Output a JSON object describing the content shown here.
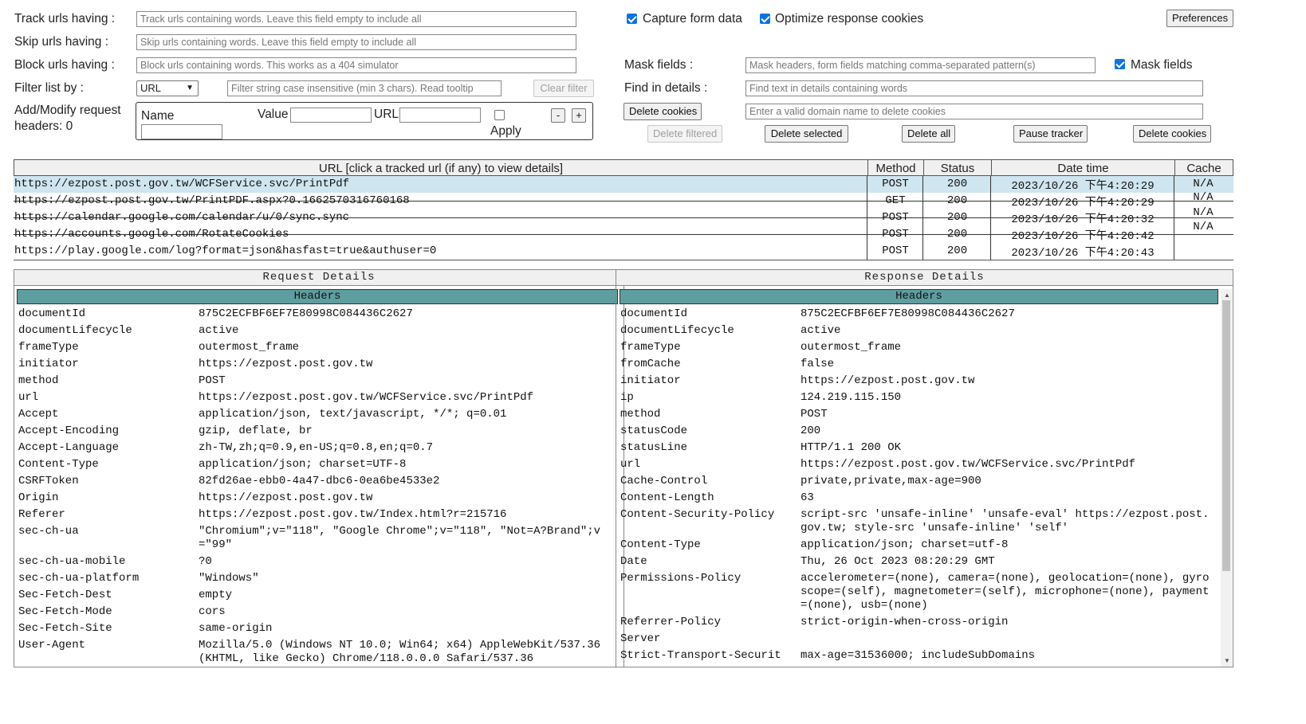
{
  "controls": {
    "track_label": "Track urls having :",
    "track_placeholder": "Track urls containing words. Leave this field empty to include all",
    "skip_label": "Skip urls having :",
    "skip_placeholder": "Skip urls containing words. Leave this field empty to include all",
    "block_label": "Block urls having :",
    "block_placeholder": "Block urls containing words. This works as a 404 simulator",
    "filter_label": "Filter list by :",
    "filter_select": "URL",
    "filter_placeholder": "Filter string case insensitive (min 3 chars). Read tooltip",
    "clear_filter": "Clear filter",
    "add_modify_label_1": "Add/Modify request",
    "add_modify_label_2": "headers: 0",
    "name_label": "Name",
    "value_label": "Value",
    "url_label": "URL",
    "apply_label": "Apply",
    "minus": "-",
    "plus": "+",
    "capture_form": "Capture form data",
    "optimize_cookies": "Optimize response cookies",
    "preferences": "Preferences",
    "mask_fields_label": "Mask fields :",
    "mask_placeholder": "Mask headers, form fields matching comma-separated pattern(s)",
    "mask_fields_check": "Mask fields",
    "find_label": "Find in details :",
    "find_placeholder": "Find text in details containing words",
    "delete_cookies": "Delete cookies",
    "domain_placeholder": "Enter a valid domain name to delete cookies",
    "delete_filtered": "Delete filtered",
    "delete_selected": "Delete selected",
    "delete_all": "Delete all",
    "pause_tracker": "Pause tracker",
    "delete_cookies_2": "Delete cookies"
  },
  "table": {
    "headers": [
      "URL [click a tracked url (if any) to view details]",
      "Method",
      "Status",
      "Date time",
      "Cache"
    ],
    "rows": [
      {
        "url": "https://ezpost.post.gov.tw/WCFService.svc/PrintPdf",
        "method": "POST",
        "status": "200",
        "date": "2023/10/26 下午4:20:29",
        "cache": "N/A"
      },
      {
        "url": "https://ezpost.post.gov.tw/PrintPDF.aspx?0.1662570316760168",
        "method": "GET",
        "status": "200",
        "date": "2023/10/26 下午4:20:29",
        "cache": "N/A"
      },
      {
        "url": "https://calendar.google.com/calendar/u/0/sync.sync",
        "method": "POST",
        "status": "200",
        "date": "2023/10/26 下午4:20:32",
        "cache": "N/A"
      },
      {
        "url": "https://accounts.google.com/RotateCookies",
        "method": "POST",
        "status": "200",
        "date": "2023/10/26 下午4:20:42",
        "cache": "N/A"
      },
      {
        "url": "https://play.google.com/log?format=json&hasfast=true&authuser=0",
        "method": "POST",
        "status": "200",
        "date": "2023/10/26 下午4:20:43",
        "cache": ""
      }
    ]
  },
  "request": {
    "title": "Request Details",
    "headers_bar": "Headers",
    "items": [
      [
        "documentId",
        "875C2ECFBF6EF7E80998C084436C2627"
      ],
      [
        "documentLifecycle",
        "active"
      ],
      [
        "frameType",
        "outermost_frame"
      ],
      [
        "initiator",
        "https://ezpost.post.gov.tw"
      ],
      [
        "method",
        "POST"
      ],
      [
        "url",
        "https://ezpost.post.gov.tw/WCFService.svc/PrintPdf"
      ],
      [
        "Accept",
        "application/json, text/javascript, */*; q=0.01"
      ],
      [
        "Accept-Encoding",
        "gzip, deflate, br"
      ],
      [
        "Accept-Language",
        "zh-TW,zh;q=0.9,en-US;q=0.8,en;q=0.7"
      ],
      [
        "Content-Type",
        "application/json; charset=UTF-8"
      ],
      [
        "CSRFToken",
        "82fd26ae-ebb0-4a47-dbc6-0ea6be4533e2"
      ],
      [
        "Origin",
        "https://ezpost.post.gov.tw"
      ],
      [
        "Referer",
        "https://ezpost.post.gov.tw/Index.html?r=215716"
      ],
      [
        "sec-ch-ua",
        "\"Chromium\";v=\"118\", \"Google Chrome\";v=\"118\", \"Not=A?Brand\";v=\"99\""
      ],
      [
        "sec-ch-ua-mobile",
        "?0"
      ],
      [
        "sec-ch-ua-platform",
        "\"Windows\""
      ],
      [
        "Sec-Fetch-Dest",
        "empty"
      ],
      [
        "Sec-Fetch-Mode",
        "cors"
      ],
      [
        "Sec-Fetch-Site",
        "same-origin"
      ],
      [
        "User-Agent",
        "Mozilla/5.0 (Windows NT 10.0; Win64; x64) AppleWebKit/537.36 (KHTML, like Gecko) Chrome/118.0.0.0 Safari/537.36"
      ]
    ]
  },
  "response": {
    "title": "Response Details",
    "headers_bar": "Headers",
    "items": [
      [
        "documentId",
        "875C2ECFBF6EF7E80998C084436C2627"
      ],
      [
        "documentLifecycle",
        "active"
      ],
      [
        "frameType",
        "outermost_frame"
      ],
      [
        "fromCache",
        "false"
      ],
      [
        "initiator",
        "https://ezpost.post.gov.tw"
      ],
      [
        "ip",
        "124.219.115.150"
      ],
      [
        "method",
        "POST"
      ],
      [
        "statusCode",
        "200"
      ],
      [
        "statusLine",
        "HTTP/1.1 200 OK"
      ],
      [
        "url",
        "https://ezpost.post.gov.tw/WCFService.svc/PrintPdf"
      ],
      [
        "Cache-Control",
        "private,private,max-age=900"
      ],
      [
        "Content-Length",
        "63"
      ],
      [
        "Content-Security-Policy",
        "script-src 'unsafe-inline' 'unsafe-eval' https://ezpost.post.gov.tw; style-src 'unsafe-inline' 'self'"
      ],
      [
        "Content-Type",
        "application/json; charset=utf-8"
      ],
      [
        "Date",
        "Thu, 26 Oct 2023 08:20:29 GMT"
      ],
      [
        "Permissions-Policy",
        "accelerometer=(none), camera=(none), geolocation=(none), gyroscope=(self), magnetometer=(self), microphone=(none), payment=(none), usb=(none)"
      ],
      [
        "Referrer-Policy",
        "strict-origin-when-cross-origin"
      ],
      [
        "Server",
        ""
      ],
      [
        "Strict-Transport-Securit",
        "max-age=31536000; includeSubDomains"
      ]
    ]
  },
  "colors": {
    "headers_bar": "#5f9ea0",
    "selected_row": "#cfe5ef",
    "checkbox": "#0b74de"
  }
}
